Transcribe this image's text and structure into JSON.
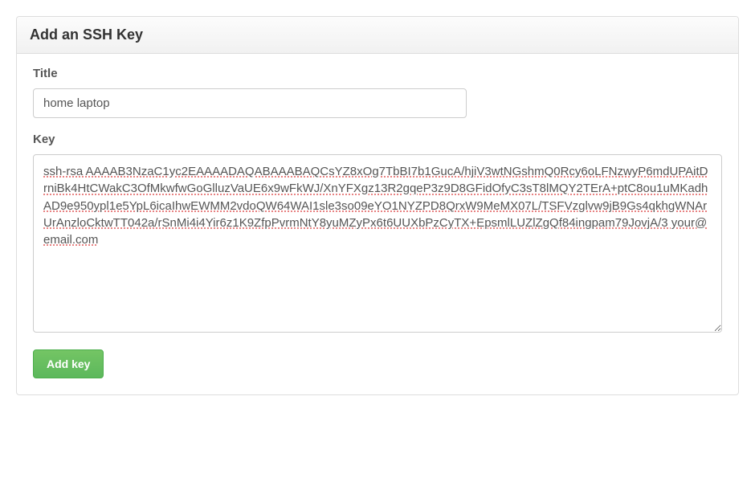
{
  "panel": {
    "title": "Add an SSH Key"
  },
  "form": {
    "title": {
      "label": "Title",
      "value": "home laptop"
    },
    "key": {
      "label": "Key",
      "value": "ssh-rsa AAAAB3NzaC1yc2EAAAADAQABAAABAQCsYZ8xOg7TbBI7b1GucA/hjiV3wtNGshmQ0Rcy6oLFNzwyP6mdUPAitDrniBk4HtCWakC3OfMkwfwGoGlluzVaUE6x9wFkWJ/XnYFXgz13R2gqeP3z9D8GFidOfyC3sT8lMQY2TErA+ptC8ou1uMKadhAD9e950ypl1e5YpL6icaIhwEWMM2vdoQW64WAI1sle3so09eYO1NYZPD8QrxW9MeMX07L/TSFVzglvw9jB9Gs4qkhgWNArUrAnzloCktwTT042a/rSnMi4i4Yir6z1K9ZfpPvrmNtY8yuMZyPx6t6UUXbPzCyTX+EpsmlLUZlZgQf84ingpam79JovjA/3 your@email.com"
    },
    "submit": {
      "label": "Add key"
    }
  }
}
